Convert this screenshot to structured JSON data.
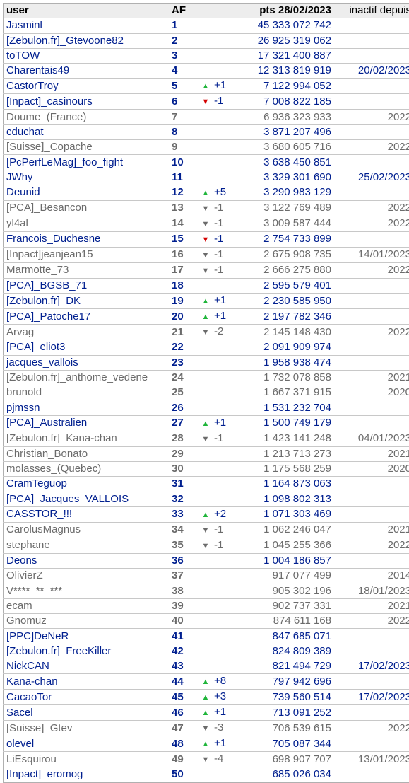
{
  "header": {
    "user": "user",
    "af": "AF",
    "pts": "pts 28/02/2023",
    "inactive": "inactif depuis"
  },
  "rows": [
    {
      "user": "Jasminl",
      "af": "1",
      "move_icon": "",
      "move": "",
      "pts": "45 333 072 742",
      "inactive_since": "",
      "status": "active"
    },
    {
      "user": "[Zebulon.fr]_Gtevoone82",
      "af": "2",
      "move_icon": "",
      "move": "",
      "pts": "26 925 319 062",
      "inactive_since": "",
      "status": "active"
    },
    {
      "user": "toTOW",
      "af": "3",
      "move_icon": "",
      "move": "",
      "pts": "17 321 400 887",
      "inactive_since": "",
      "status": "active"
    },
    {
      "user": "Charentais49",
      "af": "4",
      "move_icon": "",
      "move": "",
      "pts": "12 313 819 919",
      "inactive_since": "20/02/2023",
      "status": "active"
    },
    {
      "user": "CastorTroy",
      "af": "5",
      "move_icon": "up-arrow-icon",
      "move": "+1",
      "pts": "7 122 994 052",
      "inactive_since": "",
      "status": "active"
    },
    {
      "user": "[Inpact]_casinours",
      "af": "6",
      "move_icon": "down-arrow-red-icon",
      "move": "-1",
      "pts": "7 008 822 185",
      "inactive_since": "",
      "status": "active"
    },
    {
      "user": "Doume_(France)",
      "af": "7",
      "move_icon": "",
      "move": "",
      "pts": "6 936 323 933",
      "inactive_since": "2022",
      "status": "inactive"
    },
    {
      "user": "cduchat",
      "af": "8",
      "move_icon": "",
      "move": "",
      "pts": "3 871 207 496",
      "inactive_since": "",
      "status": "active"
    },
    {
      "user": "[Suisse]_Copache",
      "af": "9",
      "move_icon": "",
      "move": "",
      "pts": "3 680 605 716",
      "inactive_since": "2022",
      "status": "inactive"
    },
    {
      "user": "[PcPerfLeMag]_foo_fight",
      "af": "10",
      "move_icon": "",
      "move": "",
      "pts": "3 638 450 851",
      "inactive_since": "",
      "status": "active"
    },
    {
      "user": "JWhy",
      "af": "11",
      "move_icon": "",
      "move": "",
      "pts": "3 329 301 690",
      "inactive_since": "25/02/2023",
      "status": "active"
    },
    {
      "user": "Deunid",
      "af": "12",
      "move_icon": "up-arrow-icon",
      "move": "+5",
      "pts": "3 290 983 129",
      "inactive_since": "",
      "status": "active"
    },
    {
      "user": "[PCA]_Besancon",
      "af": "13",
      "move_icon": "down-arrow-grey-icon",
      "move": "-1",
      "pts": "3 122 769 489",
      "inactive_since": "2022",
      "status": "inactive"
    },
    {
      "user": "yl4al",
      "af": "14",
      "move_icon": "down-arrow-grey-icon",
      "move": "-1",
      "pts": "3 009 587 444",
      "inactive_since": "2022",
      "status": "inactive"
    },
    {
      "user": "Francois_Duchesne",
      "af": "15",
      "move_icon": "down-arrow-red-icon",
      "move": "-1",
      "pts": "2 754 733 899",
      "inactive_since": "",
      "status": "active"
    },
    {
      "user": "[Inpact]jeanjean15",
      "af": "16",
      "move_icon": "down-arrow-grey-icon",
      "move": "-1",
      "pts": "2 675 908 735",
      "inactive_since": "14/01/2023",
      "status": "inactive"
    },
    {
      "user": "Marmotte_73",
      "af": "17",
      "move_icon": "down-arrow-grey-icon",
      "move": "-1",
      "pts": "2 666 275 880",
      "inactive_since": "2022",
      "status": "inactive"
    },
    {
      "user": "[PCA]_BGSB_71",
      "af": "18",
      "move_icon": "",
      "move": "",
      "pts": "2 595 579 401",
      "inactive_since": "",
      "status": "active"
    },
    {
      "user": "[Zebulon.fr]_DK",
      "af": "19",
      "move_icon": "up-arrow-icon",
      "move": "+1",
      "pts": "2 230 585 950",
      "inactive_since": "",
      "status": "active"
    },
    {
      "user": "[PCA]_Patoche17",
      "af": "20",
      "move_icon": "up-arrow-icon",
      "move": "+1",
      "pts": "2 197 782 346",
      "inactive_since": "",
      "status": "active"
    },
    {
      "user": "Arvag",
      "af": "21",
      "move_icon": "down-arrow-grey-icon",
      "move": "-2",
      "pts": "2 145 148 430",
      "inactive_since": "2022",
      "status": "inactive"
    },
    {
      "user": "[PCA]_eliot3",
      "af": "22",
      "move_icon": "",
      "move": "",
      "pts": "2 091 909 974",
      "inactive_since": "",
      "status": "active"
    },
    {
      "user": "jacques_vallois",
      "af": "23",
      "move_icon": "",
      "move": "",
      "pts": "1 958 938 474",
      "inactive_since": "",
      "status": "active"
    },
    {
      "user": "[Zebulon.fr]_anthome_vedene",
      "af": "24",
      "move_icon": "",
      "move": "",
      "pts": "1 732 078 858",
      "inactive_since": "2021",
      "status": "inactive"
    },
    {
      "user": "brunold",
      "af": "25",
      "move_icon": "",
      "move": "",
      "pts": "1 667 371 915",
      "inactive_since": "2020",
      "status": "inactive"
    },
    {
      "user": "pjmssn",
      "af": "26",
      "move_icon": "",
      "move": "",
      "pts": "1 531 232 704",
      "inactive_since": "",
      "status": "active"
    },
    {
      "user": "[PCA]_Australien",
      "af": "27",
      "move_icon": "up-arrow-icon",
      "move": "+1",
      "pts": "1 500 749 179",
      "inactive_since": "",
      "status": "active"
    },
    {
      "user": "[Zebulon.fr]_Kana-chan",
      "af": "28",
      "move_icon": "down-arrow-grey-icon",
      "move": "-1",
      "pts": "1 423 141 248",
      "inactive_since": "04/01/2023",
      "status": "inactive"
    },
    {
      "user": "Christian_Bonato",
      "af": "29",
      "move_icon": "",
      "move": "",
      "pts": "1 213 713 273",
      "inactive_since": "2021",
      "status": "inactive"
    },
    {
      "user": "molasses_(Quebec)",
      "af": "30",
      "move_icon": "",
      "move": "",
      "pts": "1 175 568 259",
      "inactive_since": "2020",
      "status": "inactive"
    },
    {
      "user": "CramTeguop",
      "af": "31",
      "move_icon": "",
      "move": "",
      "pts": "1 164 873 063",
      "inactive_since": "",
      "status": "active"
    },
    {
      "user": "[PCA]_Jacques_VALLOIS",
      "af": "32",
      "move_icon": "",
      "move": "",
      "pts": "1 098 802 313",
      "inactive_since": "",
      "status": "active"
    },
    {
      "user": "CASSTOR_!!!",
      "af": "33",
      "move_icon": "up-arrow-icon",
      "move": "+2",
      "pts": "1 071 303 469",
      "inactive_since": "",
      "status": "active"
    },
    {
      "user": "CarolusMagnus",
      "af": "34",
      "move_icon": "down-arrow-grey-icon",
      "move": "-1",
      "pts": "1 062 246 047",
      "inactive_since": "2021",
      "status": "inactive"
    },
    {
      "user": "stephane",
      "af": "35",
      "move_icon": "down-arrow-grey-icon",
      "move": "-1",
      "pts": "1 045 255 366",
      "inactive_since": "2022",
      "status": "inactive"
    },
    {
      "user": "Deons",
      "af": "36",
      "move_icon": "",
      "move": "",
      "pts": "1 004 186 857",
      "inactive_since": "",
      "status": "active"
    },
    {
      "user": "OlivierZ",
      "af": "37",
      "move_icon": "",
      "move": "",
      "pts": "917 077 499",
      "inactive_since": "2014",
      "status": "inactive"
    },
    {
      "user": "V****_**_***",
      "af": "38",
      "move_icon": "",
      "move": "",
      "pts": "905 302 196",
      "inactive_since": "18/01/2023",
      "status": "inactive"
    },
    {
      "user": "ecam",
      "af": "39",
      "move_icon": "",
      "move": "",
      "pts": "902 737 331",
      "inactive_since": "2021",
      "status": "inactive"
    },
    {
      "user": "Gnomuz",
      "af": "40",
      "move_icon": "",
      "move": "",
      "pts": "874 611 168",
      "inactive_since": "2022",
      "status": "inactive"
    },
    {
      "user": "[PPC]DeNeR",
      "af": "41",
      "move_icon": "",
      "move": "",
      "pts": "847 685 071",
      "inactive_since": "",
      "status": "active"
    },
    {
      "user": "[Zebulon.fr]_FreeKiller",
      "af": "42",
      "move_icon": "",
      "move": "",
      "pts": "824 809 389",
      "inactive_since": "",
      "status": "active"
    },
    {
      "user": "NickCAN",
      "af": "43",
      "move_icon": "",
      "move": "",
      "pts": "821 494 729",
      "inactive_since": "17/02/2023",
      "status": "active"
    },
    {
      "user": "Kana-chan",
      "af": "44",
      "move_icon": "up-arrow-icon",
      "move": "+8",
      "pts": "797 942 696",
      "inactive_since": "",
      "status": "active"
    },
    {
      "user": "CacaoTor",
      "af": "45",
      "move_icon": "up-arrow-icon",
      "move": "+3",
      "pts": "739 560 514",
      "inactive_since": "17/02/2023",
      "status": "active"
    },
    {
      "user": "Sacel",
      "af": "46",
      "move_icon": "up-arrow-icon",
      "move": "+1",
      "pts": "713 091 252",
      "inactive_since": "",
      "status": "active"
    },
    {
      "user": "[Suisse]_Gtev",
      "af": "47",
      "move_icon": "down-arrow-grey-icon",
      "move": "-3",
      "pts": "706 539 615",
      "inactive_since": "2022",
      "status": "inactive"
    },
    {
      "user": "olevel",
      "af": "48",
      "move_icon": "up-arrow-icon",
      "move": "+1",
      "pts": "705 087 344",
      "inactive_since": "",
      "status": "active"
    },
    {
      "user": "LiEsquirou",
      "af": "49",
      "move_icon": "down-arrow-grey-icon",
      "move": "-4",
      "pts": "698 907 707",
      "inactive_since": "13/01/2023",
      "status": "inactive"
    },
    {
      "user": "[Inpact]_eromog",
      "af": "50",
      "move_icon": "",
      "move": "",
      "pts": "685 026 034",
      "inactive_since": "",
      "status": "active"
    }
  ],
  "icons": {
    "up-arrow-icon": "▲",
    "down-arrow-red-icon": "▼",
    "down-arrow-grey-icon": "▼"
  },
  "colors": {
    "active_text": "#001f8f",
    "inactive_text": "#6b6b6b",
    "up_arrow": "#1fb53a",
    "down_arrow_red": "#d40000",
    "header_bg": "#ededed"
  }
}
